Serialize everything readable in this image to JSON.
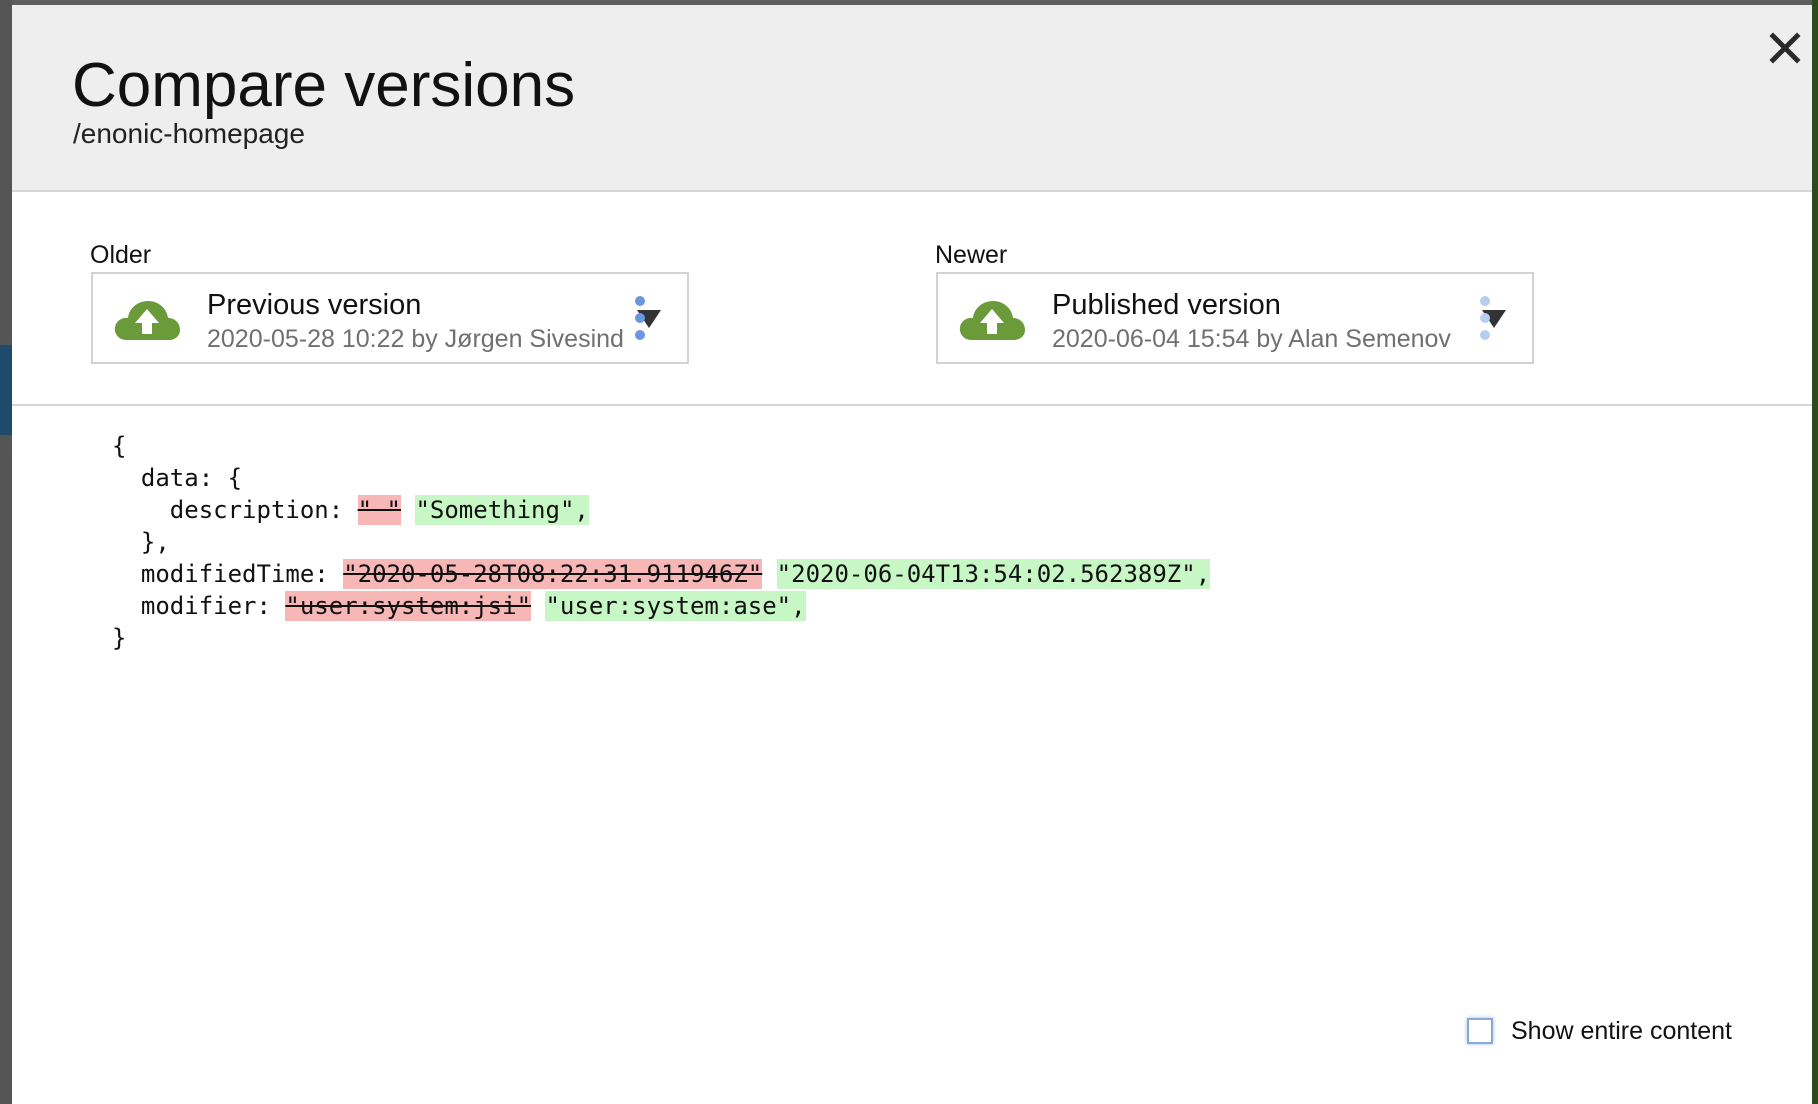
{
  "dialog": {
    "title": "Compare versions",
    "path": "/enonic-homepage"
  },
  "older": {
    "label": "Older",
    "version_name": "Previous version",
    "version_meta": "2020-05-28 10:22 by Jørgen Sivesind"
  },
  "newer": {
    "label": "Newer",
    "version_name": "Published version",
    "version_meta": "2020-06-04 15:54 by Alan Semenov"
  },
  "diff": {
    "open_brace": "{",
    "data_key": "  data: {",
    "description_key": "    description: ",
    "description_old": "\" \"",
    "description_new": "\"Something\",",
    "data_close": "  },",
    "modified_time_key": "  modifiedTime: ",
    "modified_time_old": "\"2020-05-28T08:22:31.911946Z\"",
    "modified_time_new": "\"2020-06-04T13:54:02.562389Z\",",
    "modifier_key": "  modifier: ",
    "modifier_old": "\"user:system:jsi\"",
    "modifier_new": "\"user:system:ase\",",
    "close_brace": "}"
  },
  "footer": {
    "show_entire_label": "Show entire content",
    "show_entire_checked": false
  },
  "colors": {
    "removed_bg": "#f7b7b7",
    "added_bg": "#c6f7c4",
    "cloud_icon": "#6a9a3a",
    "menu_dots": "#6a96e0",
    "menu_dots_faded": "#b7cdf2"
  },
  "icons": {
    "close": "close-icon",
    "version_status": "cloud-upload-icon",
    "dropdown": "chevron-down-icon",
    "menu": "more-vertical-icon"
  }
}
